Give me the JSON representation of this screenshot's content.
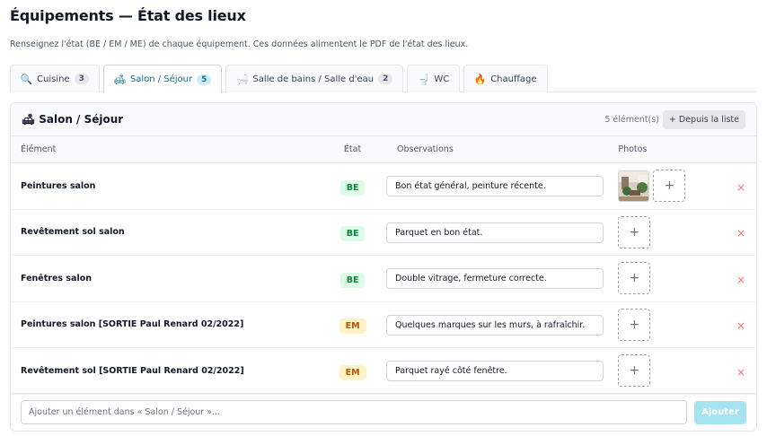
{
  "page": {
    "title": "Équipements — État des lieux",
    "subtitle": "Renseignez l'état (BE / EM / ME) de chaque équipement. Ces données alimentent le PDF de l'état des lieux."
  },
  "tabs": [
    {
      "label": "Cuisine",
      "count": "3",
      "icon": "magnifier-icon",
      "glyph": "🔍",
      "active": false
    },
    {
      "label": "Salon / Séjour",
      "count": "5",
      "icon": "sofa-icon",
      "glyph": "🛋",
      "active": true
    },
    {
      "label": "Salle de bains / Salle d'eau",
      "count": "2",
      "icon": "bathtub-icon",
      "glyph": "🛁",
      "active": false
    },
    {
      "label": "WC",
      "count": "",
      "icon": "toilet-icon",
      "glyph": "🚽",
      "active": false
    },
    {
      "label": "Chauffage",
      "count": "",
      "icon": "fire-icon",
      "glyph": "🔥",
      "active": false
    }
  ],
  "panel": {
    "title": "Salon / Séjour",
    "icon": "sofa-icon",
    "count_text": "5 élément(s)",
    "from_list_label": "+ Depuis la liste"
  },
  "columns": {
    "element": "Élément",
    "etat": "État",
    "observations": "Observations",
    "photos": "Photos"
  },
  "rows": [
    {
      "element": "Peintures salon",
      "etat": "BE",
      "observation": "Bon état général, peinture récente.",
      "has_photo": true
    },
    {
      "element": "Revêtement sol salon",
      "etat": "BE",
      "observation": "Parquet en bon état.",
      "has_photo": false
    },
    {
      "element": "Fenêtres salon",
      "etat": "BE",
      "observation": "Double vitrage, fermeture correcte.",
      "has_photo": false
    },
    {
      "element": "Peintures salon [SORTIE Paul Renard 02/2022]",
      "etat": "EM",
      "observation": "Quelques marques sur les murs, à rafraîchir.",
      "has_photo": false
    },
    {
      "element": "Revêtement sol [SORTIE Paul Renard 02/2022]",
      "etat": "EM",
      "observation": "Parquet rayé côté fenêtre.",
      "has_photo": false
    }
  ],
  "add_bar": {
    "placeholder": "Ajouter un élément dans « Salon / Séjour »...",
    "button_label": "Ajouter"
  },
  "icons": {
    "add_photo": "+",
    "delete": "×"
  },
  "colors": {
    "accent": "#0e7490",
    "be_bg": "#dcfce7",
    "be_text": "#15803d",
    "em_bg": "#fef3c7",
    "em_text": "#b45309",
    "delete": "#f87171",
    "add_button": "#a5e3f0"
  }
}
